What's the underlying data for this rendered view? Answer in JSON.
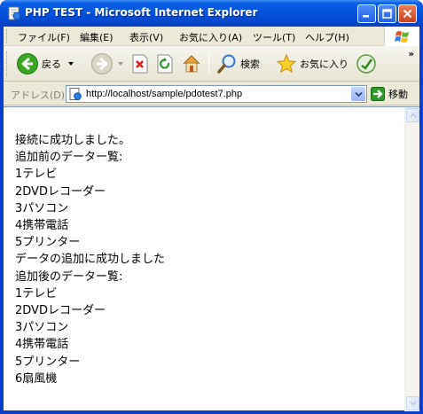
{
  "window": {
    "title": "PHP TEST - Microsoft Internet Explorer"
  },
  "menubar": {
    "items": [
      {
        "label": "ファイル(F)"
      },
      {
        "label": "編集(E)"
      },
      {
        "label": "表示(V)"
      },
      {
        "label": "お気に入り(A)"
      },
      {
        "label": "ツール(T)"
      },
      {
        "label": "ヘルプ(H)"
      }
    ]
  },
  "toolbar": {
    "back_label": "戻る",
    "search_label": "検索",
    "favorites_label": "お気に入り"
  },
  "addressbar": {
    "label": "アドレス(D)",
    "url": "http://localhost/sample/pdotest7.php",
    "go_label": "移動"
  },
  "content": {
    "lines": [
      "接続に成功しました。",
      "追加前のデーター覧:",
      "1テレビ",
      "2DVDレコーダー",
      "3パソコン",
      "4携帯電話",
      "5プリンター",
      "データの追加に成功しました",
      "追加後のデーター覧:",
      "1テレビ",
      "2DVDレコーダー",
      "3パソコン",
      "4携帯電話",
      "5プリンター",
      "6扇風機"
    ]
  },
  "colors": {
    "titlebar": "#0453dc",
    "chrome": "#ece9d8",
    "back_green": "#3aa520",
    "close_red": "#c5411c"
  }
}
